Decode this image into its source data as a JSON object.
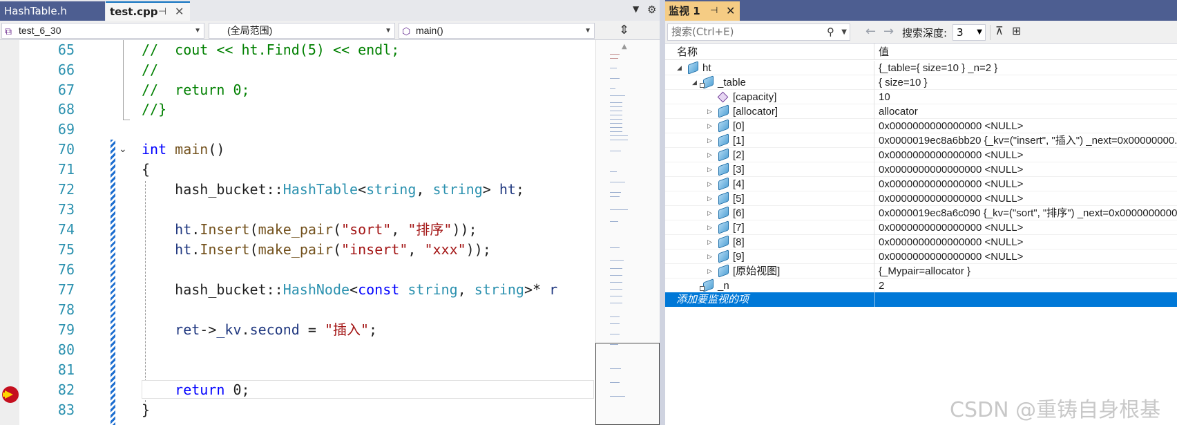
{
  "editor": {
    "tabs": [
      {
        "label": "HashTable.h"
      },
      {
        "label": "test.cpp"
      }
    ],
    "tab_pin_glyph": "⊣",
    "tab_close_glyph": "✕",
    "nav": {
      "project": "test_6_30",
      "scope": "(全局范围)",
      "function": "main()"
    },
    "line_numbers": [
      "65",
      "66",
      "67",
      "68",
      "69",
      "70",
      "71",
      "72",
      "73",
      "74",
      "75",
      "76",
      "77",
      "78",
      "79",
      "80",
      "81",
      "82",
      "83"
    ],
    "current_line": "82"
  },
  "watch": {
    "tab_label": "监视 1",
    "search_placeholder": "搜索(Ctrl+E)",
    "depth_label": "搜索深度:",
    "depth_value": "3",
    "columns": {
      "name": "名称",
      "value": "值"
    },
    "rows": [
      {
        "name": "ht",
        "value": "{_table={ size=10 } _n=2 }"
      },
      {
        "name": "_table",
        "value": "{ size=10 }"
      },
      {
        "name": "[capacity]",
        "value": "10"
      },
      {
        "name": "[allocator]",
        "value": "allocator"
      },
      {
        "name": "[0]",
        "value": "0x0000000000000000 <NULL>"
      },
      {
        "name": "[1]",
        "value": "0x0000019ec8a6bb20 {_kv=(\"insert\", \"插入\") _next=0x00000000..."
      },
      {
        "name": "[2]",
        "value": "0x0000000000000000 <NULL>"
      },
      {
        "name": "[3]",
        "value": "0x0000000000000000 <NULL>"
      },
      {
        "name": "[4]",
        "value": "0x0000000000000000 <NULL>"
      },
      {
        "name": "[5]",
        "value": "0x0000000000000000 <NULL>"
      },
      {
        "name": "[6]",
        "value": "0x0000019ec8a6c090 {_kv=(\"sort\", \"排序\") _next=0x0000000000..."
      },
      {
        "name": "[7]",
        "value": "0x0000000000000000 <NULL>"
      },
      {
        "name": "[8]",
        "value": "0x0000000000000000 <NULL>"
      },
      {
        "name": "[9]",
        "value": "0x0000000000000000 <NULL>"
      },
      {
        "name": "[原始视图]",
        "value": "{_Mypair=allocator }"
      },
      {
        "name": "_n",
        "value": "2"
      }
    ],
    "add_watch_label": "添加要监视的项"
  },
  "watermark": "CSDN @重铸自身根基",
  "colors": {
    "accent_blue": "#0078d7",
    "tab_active_yellow": "#f5cc84",
    "tab_bar_navy": "#4d5e91",
    "keyword": "#0000ff",
    "comment": "#008000",
    "type": "#2b91af",
    "string": "#a31515"
  }
}
